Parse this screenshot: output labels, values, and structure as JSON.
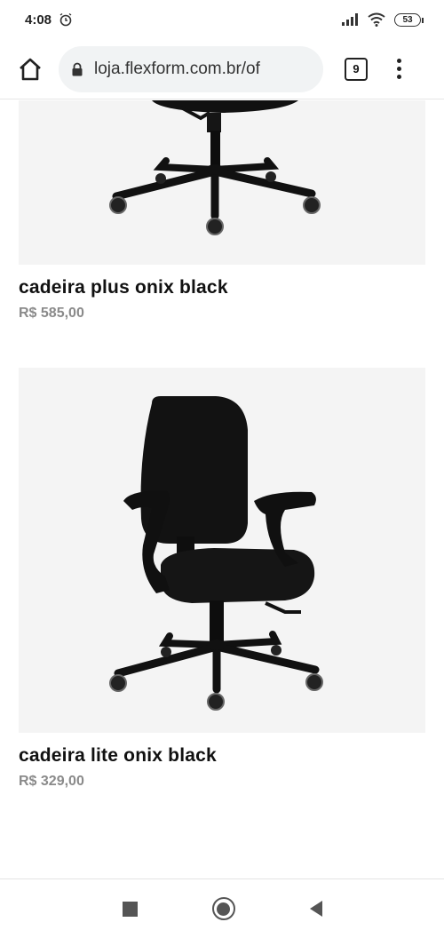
{
  "status_bar": {
    "time": "4:08",
    "alarm_icon": "alarm-icon",
    "signal_icon": "signal-icon",
    "wifi_icon": "wifi-icon",
    "battery_level": "53"
  },
  "browser": {
    "url": "loja.flexform.com.br/of",
    "tab_count": "9",
    "icons": [
      "home-icon",
      "lock-icon",
      "tabs-icon",
      "more-vert-icon"
    ]
  },
  "products": [
    {
      "name": "cadeira plus onix black",
      "price": "R$ 585,00"
    },
    {
      "name": "cadeira lite onix black",
      "price": "R$ 329,00"
    }
  ],
  "nav_bar": {
    "icons": [
      "recents-icon",
      "home-icon",
      "back-icon"
    ]
  },
  "colors": {
    "image_background": "#f4f4f4",
    "price": "#8a8a8a",
    "chair": "#111111"
  }
}
